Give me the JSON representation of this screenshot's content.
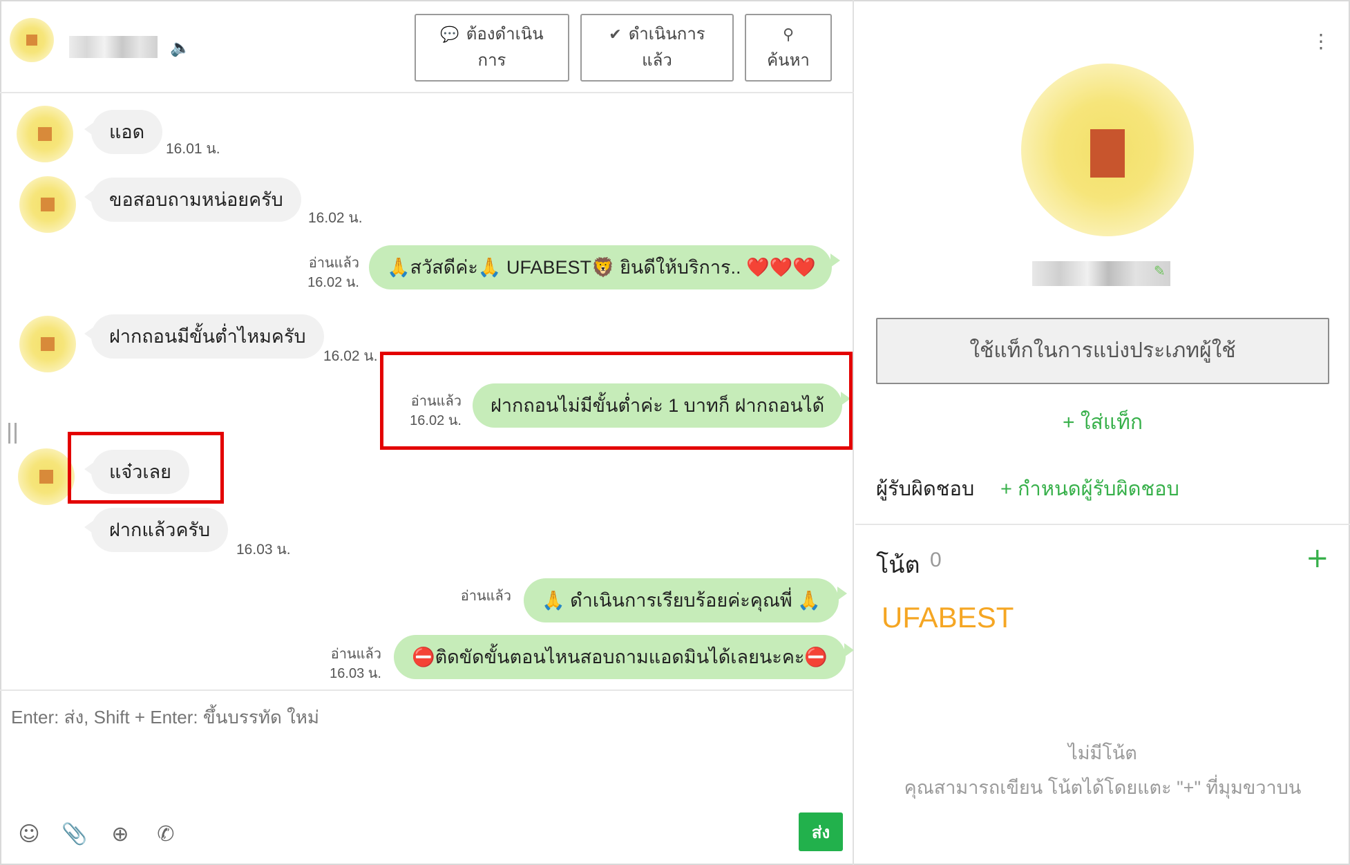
{
  "header": {
    "buttons": {
      "pending": {
        "line1": "ต้องดำเนิน",
        "line2": "การ",
        "icon": "chat-bubble-icon"
      },
      "done": {
        "line1": "ดำเนินการ",
        "line2": "แล้ว",
        "icon": "check-circle-icon"
      },
      "search": {
        "line1": "ค้นหา",
        "icon": "search-icon"
      }
    }
  },
  "messages": [
    {
      "direction": "in",
      "text": "แอด",
      "time": "16.01 น."
    },
    {
      "direction": "in",
      "text": "ขอสอบถามหน่อยครับ",
      "time": "16.02 น."
    },
    {
      "direction": "out",
      "text": "🙏สวัสดีค่ะ🙏 UFABEST🦁 ยินดีให้บริการ.. ❤️❤️❤️",
      "read": "อ่านแล้ว",
      "time": "16.02 น."
    },
    {
      "direction": "in",
      "text": "ฝากถอนมีขั้นต่ำไหมครับ",
      "time": "16.02 น."
    },
    {
      "direction": "out",
      "text": "ฝากถอนไม่มีขั้นต่ำค่ะ 1 บาทก็ ฝากถอนได้",
      "read": "อ่านแล้ว",
      "time": "16.02 น."
    },
    {
      "direction": "in",
      "text": "แจ๋วเลย",
      "time": ""
    },
    {
      "direction": "in",
      "text": "ฝากแล้วครับ",
      "time": "16.03 น."
    },
    {
      "direction": "out",
      "text": "🙏 ดำเนินการเรียบร้อยค่ะคุณพี่ 🙏",
      "read": "อ่านแล้ว",
      "time": ""
    },
    {
      "direction": "out",
      "text": "⛔ติดขัดขั้นตอนไหนสอบถามแอดมินได้เลยนะคะ⛔",
      "read": "อ่านแล้ว",
      "time": "16.03 น."
    }
  ],
  "composer": {
    "placeholder": "Enter: ส่ง, Shift + Enter: ขึ้นบรรทัด ใหม่",
    "send_label": "ส่ง",
    "tools": [
      "emoji-icon",
      "paperclip-icon",
      "add-chat-icon",
      "phone-icon"
    ]
  },
  "sidebar": {
    "tag_button": "ใช้แท็กในการแบ่งประเภทผู้ใช้",
    "add_tag": "+ ใส่แท็ก",
    "responsible_label": "ผู้รับผิดชอบ",
    "responsible_link": "+ กำหนดผู้รับผิดชอบ",
    "notes_title": "โน้ต",
    "notes_count": "0",
    "note_brand": "UFABEST",
    "empty_title": "ไม่มีโน้ต",
    "empty_hint": "คุณสามารถเขียน โน้ตได้โดยแตะ \"+\" ที่มุมขวาบน"
  },
  "colors": {
    "incoming_bubble": "#f1f1f1",
    "outgoing_bubble": "#c6ecb9",
    "accent_green": "#37b04a",
    "send_button": "#22b14c",
    "highlight_box": "#e30000",
    "brand_orange": "#f5a623"
  }
}
